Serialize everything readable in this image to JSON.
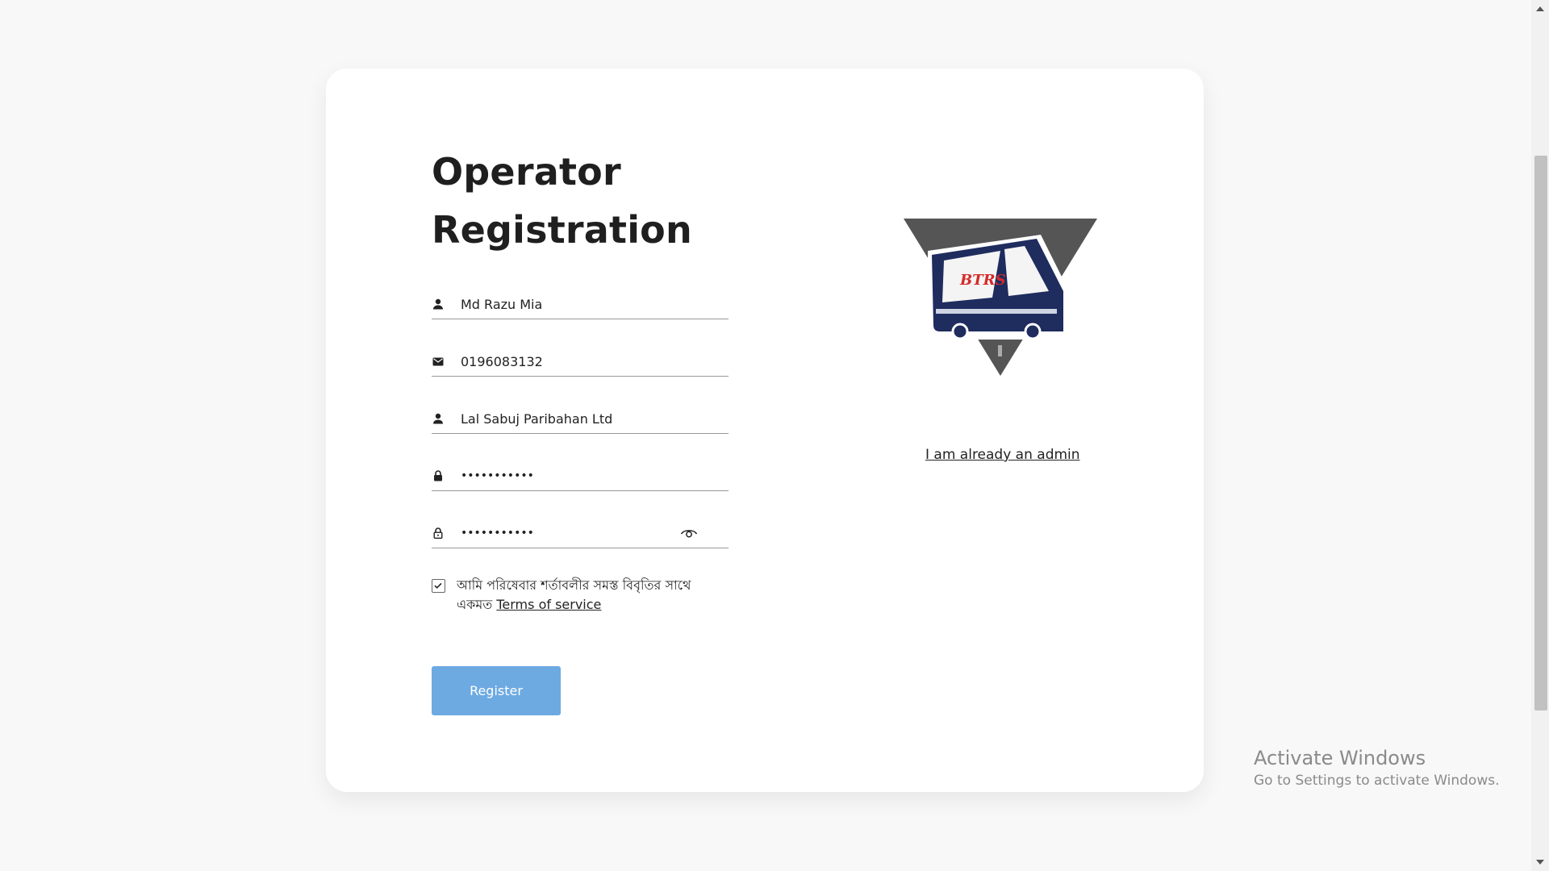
{
  "form": {
    "title_line1": "Operator",
    "title_line2": "Registration",
    "name_value": "Md Razu Mia",
    "phone_value": "0196083132",
    "company_value": "Lal Sabuj Paribahan Ltd",
    "password_value": "12345678901",
    "confirm_password_value": "12345678901",
    "terms_text": "আমি পরিষেবার শর্তাবলীর সমস্ত বিবৃতির সাথে একমত",
    "terms_link": "Terms of service",
    "register_label": "Register",
    "icons": {
      "name": "user-icon",
      "phone": "mail-icon",
      "company": "user-icon",
      "password": "lock-icon",
      "confirm": "unlock-icon",
      "toggle": "eye-icon",
      "checkbox": "check-icon"
    },
    "colors": {
      "register_bg": "#6daae2",
      "card_bg": "#ffffff",
      "page_bg": "#f8f8f8"
    }
  },
  "brand": {
    "logo_text": "BTRS"
  },
  "links": {
    "admin": "I am already an admin"
  },
  "watermark": {
    "title": "Activate Windows",
    "subtitle": "Go to Settings to activate Windows."
  }
}
